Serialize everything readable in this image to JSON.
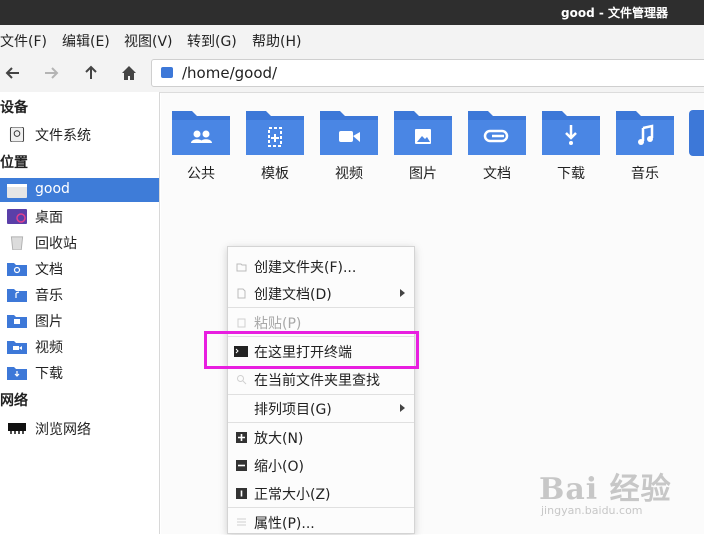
{
  "window": {
    "title": "good - 文件管理器"
  },
  "menu": [
    "文件(F)",
    "编辑(E)",
    "视图(V)",
    "转到(G)",
    "帮助(H)"
  ],
  "toolbar": {
    "path": "/home/good/"
  },
  "sidebar": {
    "devices_heading": "设备",
    "devices": [
      {
        "label": "文件系统",
        "icon": "drive-icon"
      }
    ],
    "places_heading": "位置",
    "places": [
      {
        "label": "good",
        "icon": "home-folder-icon",
        "selected": true
      },
      {
        "label": "桌面",
        "icon": "desktop-icon"
      },
      {
        "label": "回收站",
        "icon": "trash-icon"
      },
      {
        "label": "文档",
        "icon": "documents-folder-icon"
      },
      {
        "label": "音乐",
        "icon": "music-folder-icon"
      },
      {
        "label": "图片",
        "icon": "pictures-folder-icon"
      },
      {
        "label": "视频",
        "icon": "videos-folder-icon"
      },
      {
        "label": "下载",
        "icon": "downloads-folder-icon"
      }
    ],
    "network_heading": "网络",
    "network": [
      {
        "label": "浏览网络",
        "icon": "network-icon"
      }
    ]
  },
  "folders": [
    {
      "label": "公共",
      "icon": "people-icon"
    },
    {
      "label": "模板",
      "icon": "template-icon"
    },
    {
      "label": "视频",
      "icon": "video-icon"
    },
    {
      "label": "图片",
      "icon": "picture-icon"
    },
    {
      "label": "文档",
      "icon": "link-icon"
    },
    {
      "label": "下载",
      "icon": "download-icon"
    },
    {
      "label": "音乐",
      "icon": "music-icon"
    }
  ],
  "context_menu": {
    "create_folder": "创建文件夹(F)...",
    "create_document": "创建文档(D)",
    "paste": "粘贴(P)",
    "open_terminal": "在这里打开终端",
    "find_here": "在当前文件夹里查找",
    "arrange": "排列项目(G)",
    "zoom_in": "放大(N)",
    "zoom_out": "缩小(O)",
    "normal_size": "正常大小(Z)",
    "properties": "属性(P)..."
  },
  "watermark": {
    "text": "Bai 经验",
    "url": "jingyan.baidu.com"
  },
  "colors": {
    "accent": "#3e7cd8",
    "folder": "#3d78d8",
    "highlight": "#e81ee0"
  }
}
